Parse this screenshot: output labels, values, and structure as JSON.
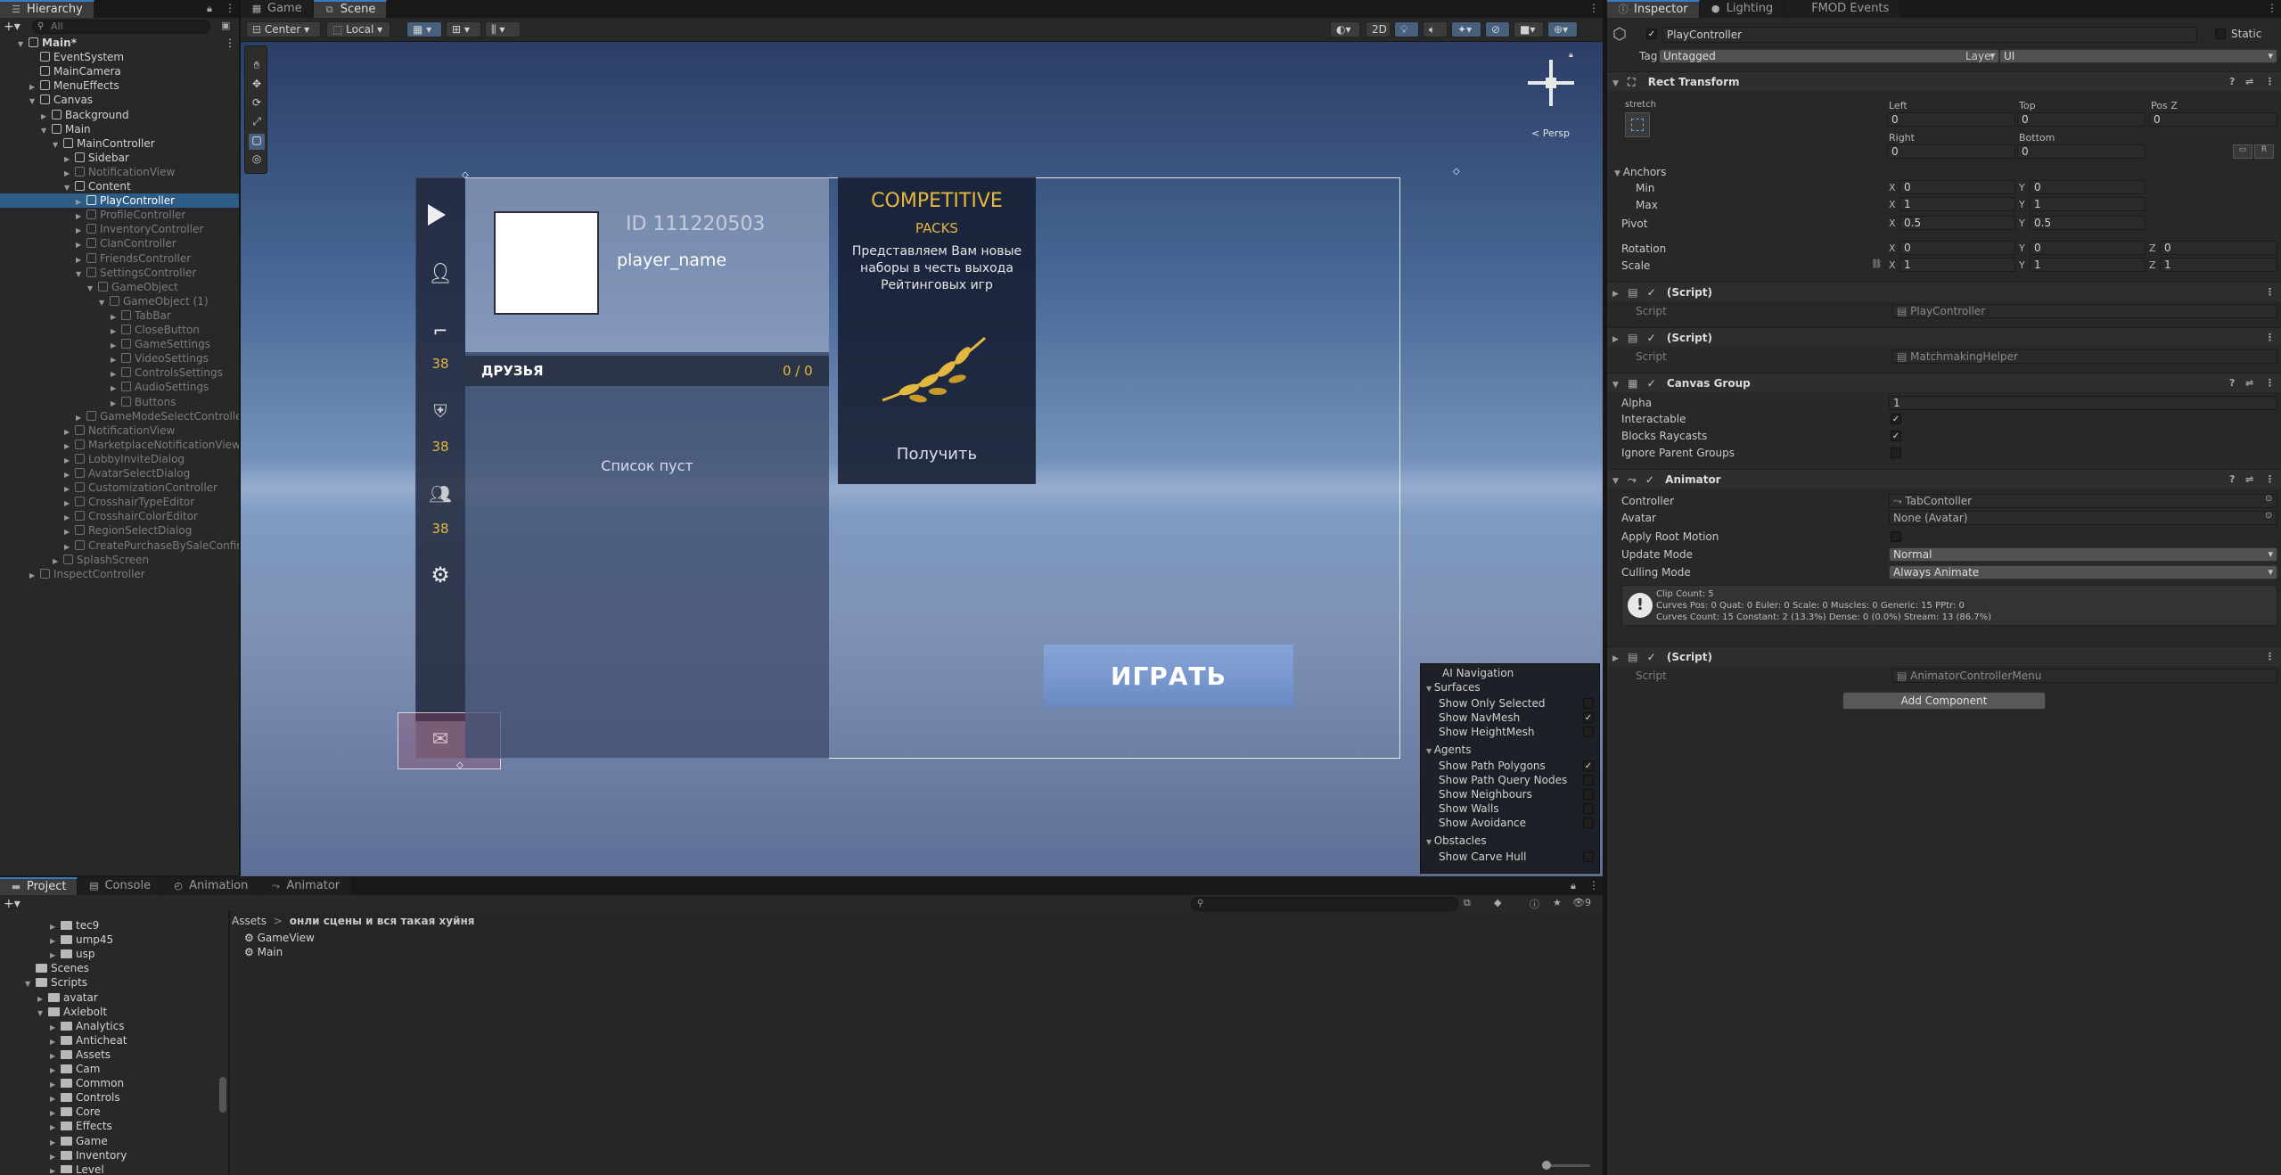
{
  "hierarchy": {
    "tab": "Hierarchy",
    "search_placeholder": "All",
    "items": [
      {
        "label": "Main*",
        "depth": 0,
        "state": "normal",
        "expanded": true,
        "scene": true
      },
      {
        "label": "EventSystem",
        "depth": 1,
        "state": "normal"
      },
      {
        "label": "MainCamera",
        "depth": 1,
        "state": "normal"
      },
      {
        "label": "MenuEffects",
        "depth": 1,
        "state": "normal",
        "collapsed": true
      },
      {
        "label": "Canvas",
        "depth": 1,
        "state": "normal",
        "expanded": true
      },
      {
        "label": "Background",
        "depth": 2,
        "state": "normal",
        "collapsed": true
      },
      {
        "label": "Main",
        "depth": 2,
        "state": "normal",
        "expanded": true
      },
      {
        "label": "MainController",
        "depth": 3,
        "state": "normal",
        "expanded": true
      },
      {
        "label": "Sidebar",
        "depth": 4,
        "state": "normal",
        "collapsed": true
      },
      {
        "label": "NotificationView",
        "depth": 4,
        "state": "dim",
        "collapsed": true
      },
      {
        "label": "Content",
        "depth": 4,
        "state": "normal",
        "expanded": true
      },
      {
        "label": "PlayController",
        "depth": 5,
        "state": "selected",
        "collapsed": true
      },
      {
        "label": "ProfileController",
        "depth": 5,
        "state": "dim",
        "collapsed": true
      },
      {
        "label": "InventoryController",
        "depth": 5,
        "state": "dim",
        "collapsed": true
      },
      {
        "label": "ClanController",
        "depth": 5,
        "state": "dim",
        "collapsed": true
      },
      {
        "label": "FriendsController",
        "depth": 5,
        "state": "dim",
        "collapsed": true
      },
      {
        "label": "SettingsController",
        "depth": 5,
        "state": "dim",
        "expanded": true
      },
      {
        "label": "GameObject",
        "depth": 6,
        "state": "dim",
        "expanded": true
      },
      {
        "label": "GameObject (1)",
        "depth": 7,
        "state": "dim",
        "expanded": true
      },
      {
        "label": "TabBar",
        "depth": 8,
        "state": "dim",
        "collapsed": true
      },
      {
        "label": "CloseButton",
        "depth": 8,
        "state": "dim",
        "collapsed": true
      },
      {
        "label": "GameSettings",
        "depth": 8,
        "state": "dim",
        "collapsed": true
      },
      {
        "label": "VideoSettings",
        "depth": 8,
        "state": "dim",
        "collapsed": true
      },
      {
        "label": "ControlsSettings",
        "depth": 8,
        "state": "dim",
        "collapsed": true
      },
      {
        "label": "AudioSettings",
        "depth": 8,
        "state": "dim",
        "collapsed": true
      },
      {
        "label": "Buttons",
        "depth": 8,
        "state": "dim",
        "collapsed": true
      },
      {
        "label": "GameModeSelectController",
        "depth": 5,
        "state": "dim",
        "collapsed": true
      },
      {
        "label": "NotificationView",
        "depth": 4,
        "state": "dim",
        "collapsed": true
      },
      {
        "label": "MarketplaceNotificationView",
        "depth": 4,
        "state": "dim",
        "collapsed": true
      },
      {
        "label": "LobbyInviteDialog",
        "depth": 4,
        "state": "dim",
        "collapsed": true
      },
      {
        "label": "AvatarSelectDialog",
        "depth": 4,
        "state": "dim",
        "collapsed": true
      },
      {
        "label": "CustomizationController",
        "depth": 4,
        "state": "dim",
        "collapsed": true
      },
      {
        "label": "CrosshairTypeEditor",
        "depth": 4,
        "state": "dim",
        "collapsed": true
      },
      {
        "label": "CrosshairColorEditor",
        "depth": 4,
        "state": "dim",
        "collapsed": true
      },
      {
        "label": "RegionSelectDialog",
        "depth": 4,
        "state": "dim",
        "collapsed": true
      },
      {
        "label": "CreatePurchaseBySaleConfirm",
        "depth": 4,
        "state": "dim",
        "collapsed": true
      },
      {
        "label": "SplashScreen",
        "depth": 3,
        "state": "dim",
        "collapsed": true
      },
      {
        "label": "InspectController",
        "depth": 1,
        "state": "dim",
        "collapsed": true
      }
    ]
  },
  "center_tabs": [
    {
      "label": "Game",
      "active": false
    },
    {
      "label": "Scene",
      "active": true
    }
  ],
  "scene_toolbar": {
    "pivot": "Center",
    "space": "Local",
    "mode_2d": "2D",
    "persp": "< Persp"
  },
  "game_ui": {
    "player_id": "ID 111220503",
    "player_name": "player_name",
    "friends_title": "ДРУЗЬЯ",
    "friends_count": "0 / 0",
    "friends_empty": "Список пуст",
    "sidebar_badges": [
      "38",
      "38",
      "38"
    ],
    "promo_title": "COMPETITIVE",
    "promo_subtitle": "PACKS",
    "promo_text": "Представляем Вам новые наборы в честь выхода Рейтинговых игр",
    "promo_button": "Получить",
    "play_button": "ИГРАТЬ"
  },
  "ai_navigation": {
    "title": "AI Navigation",
    "sections": [
      {
        "title": "Surfaces",
        "items": [
          {
            "label": "Show Only Selected",
            "checked": false
          },
          {
            "label": "Show NavMesh",
            "checked": true
          },
          {
            "label": "Show HeightMesh",
            "checked": false
          }
        ]
      },
      {
        "title": "Agents",
        "items": [
          {
            "label": "Show Path Polygons",
            "checked": true
          },
          {
            "label": "Show Path Query Nodes",
            "checked": false
          },
          {
            "label": "Show Neighbours",
            "checked": false
          },
          {
            "label": "Show Walls",
            "checked": false
          },
          {
            "label": "Show Avoidance",
            "checked": false
          }
        ]
      },
      {
        "title": "Obstacles",
        "items": [
          {
            "label": "Show Carve Hull",
            "checked": false
          }
        ]
      }
    ]
  },
  "bottom_tabs": [
    {
      "label": "Project",
      "active": true
    },
    {
      "label": "Console",
      "active": false
    },
    {
      "label": "Animation",
      "active": false
    },
    {
      "label": "Animator",
      "active": false
    }
  ],
  "project": {
    "breadcrumb_root": "Assets",
    "breadcrumb_sep": ">",
    "breadcrumb_folder": "онли сцены и вся такая хуйня",
    "files": [
      "GameView",
      "Main"
    ],
    "badge_count": "9",
    "tree": [
      {
        "label": "tec9",
        "depth": 3
      },
      {
        "label": "ump45",
        "depth": 3
      },
      {
        "label": "usp",
        "depth": 3
      },
      {
        "label": "Scenes",
        "depth": 1
      },
      {
        "label": "Scripts",
        "depth": 1
      },
      {
        "label": "avatar",
        "depth": 2
      },
      {
        "label": "Axlebolt",
        "depth": 2
      },
      {
        "label": "Analytics",
        "depth": 3
      },
      {
        "label": "Anticheat",
        "depth": 3
      },
      {
        "label": "Assets",
        "depth": 3
      },
      {
        "label": "Cam",
        "depth": 3
      },
      {
        "label": "Common",
        "depth": 3
      },
      {
        "label": "Controls",
        "depth": 3
      },
      {
        "label": "Core",
        "depth": 3
      },
      {
        "label": "Effects",
        "depth": 3
      },
      {
        "label": "Game",
        "depth": 3
      },
      {
        "label": "Inventory",
        "depth": 3
      },
      {
        "label": "Level",
        "depth": 3
      }
    ]
  },
  "inspector": {
    "tabs": [
      {
        "label": "Inspector",
        "active": true
      },
      {
        "label": "Lighting",
        "active": false
      },
      {
        "label": "FMOD Events",
        "active": false
      }
    ],
    "object_name": "PlayController",
    "static_label": "Static",
    "tag_label": "Tag",
    "tag_value": "Untagged",
    "layer_label": "Layer",
    "layer_value": "UI",
    "rect_transform": {
      "title": "Rect Transform",
      "anchor_preset": "stretch",
      "left_label": "Left",
      "left": "0",
      "top_label": "Top",
      "top": "0",
      "posz_label": "Pos Z",
      "posz": "0",
      "right_label": "Right",
      "right": "0",
      "bottom_label": "Bottom",
      "bottom": "0",
      "anchors_label": "Anchors",
      "min_label": "Min",
      "min_x": "0",
      "min_y": "0",
      "max_label": "Max",
      "max_x": "1",
      "max_y": "1",
      "pivot_label": "Pivot",
      "pivot_x": "0.5",
      "pivot_y": "0.5",
      "rotation_label": "Rotation",
      "rot_x": "0",
      "rot_y": "0",
      "rot_z": "0",
      "scale_label": "Scale",
      "scale_x": "1",
      "scale_y": "1",
      "scale_z": "1"
    },
    "scripts": [
      {
        "title": "(Script)",
        "script_label": "Script",
        "value": "PlayController"
      },
      {
        "title": "(Script)",
        "script_label": "Script",
        "value": "MatchmakingHelper"
      }
    ],
    "canvas_group": {
      "title": "Canvas Group",
      "alpha_label": "Alpha",
      "alpha": "1",
      "interactable_label": "Interactable",
      "blocks_label": "Blocks Raycasts",
      "ignore_label": "Ignore Parent Groups"
    },
    "animator": {
      "title": "Animator",
      "controller_label": "Controller",
      "controller": "TabContoller",
      "avatar_label": "Avatar",
      "avatar": "None (Avatar)",
      "root_motion_label": "Apply Root Motion",
      "update_label": "Update Mode",
      "update": "Normal",
      "culling_label": "Culling Mode",
      "culling": "Always Animate",
      "info1": "Clip Count: 5",
      "info2": "Curves Pos: 0 Quat: 0 Euler: 0 Scale: 0 Muscles: 0 Generic: 15 PPtr: 0",
      "info3": "Curves Count: 15 Constant: 2 (13.3%) Dense: 0 (0.0%) Stream: 13 (86.7%)"
    },
    "script3": {
      "title": "(Script)",
      "script_label": "Script",
      "value": "AnimatorControllerMenu"
    },
    "add_component": "Add Component"
  },
  "colors": {
    "selection": "#2c5d87",
    "accent": "#e4b73f",
    "play": "#7fa0d4"
  }
}
